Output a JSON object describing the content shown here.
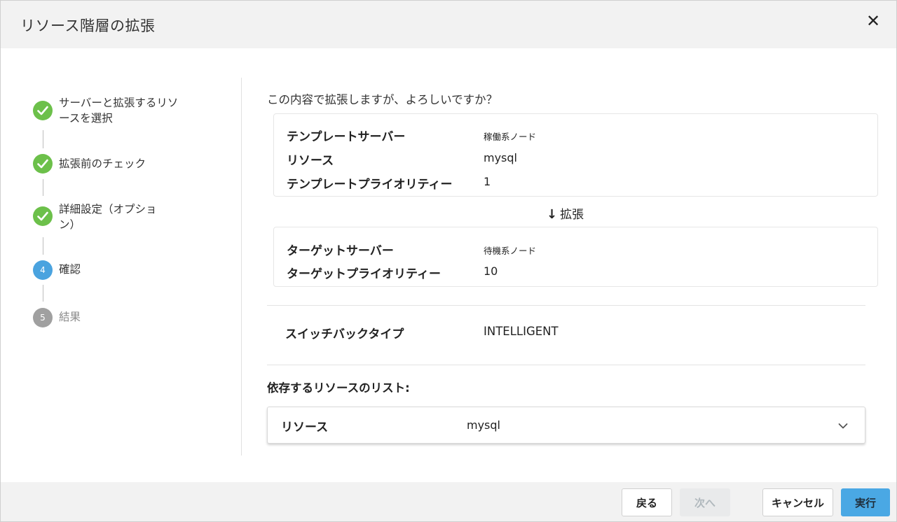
{
  "dialog": {
    "title": "リソース階層の拡張",
    "close_label": "✕"
  },
  "stepper": {
    "steps": [
      {
        "label": "サーバーと拡張するリソースを選択",
        "status": "done",
        "number": "1"
      },
      {
        "label": "拡張前のチェック",
        "status": "done",
        "number": "2"
      },
      {
        "label": "詳細設定（オプション）",
        "status": "done",
        "number": "3"
      },
      {
        "label": "確認",
        "status": "current",
        "number": "4"
      },
      {
        "label": "結果",
        "status": "pending",
        "number": "5"
      }
    ]
  },
  "confirm": {
    "question": "この内容で拡張しますが、よろしいですか？",
    "template": {
      "server_label": "テンプレートサーバー",
      "server_value": "稼働系ノード",
      "resource_label": "リソース",
      "resource_value": "mysql",
      "priority_label": "テンプレートプライオリティー",
      "priority_value": "1"
    },
    "expand_text": "拡張",
    "target": {
      "server_label": "ターゲットサーバー",
      "server_value": "待機系ノード",
      "priority_label": "ターゲットプライオリティー",
      "priority_value": "10"
    },
    "switchback_label": "スイッチバックタイプ",
    "switchback_value": "INTELLIGENT",
    "deps_title": "依存するリソースのリスト:",
    "deps": {
      "resource_label": "リソース",
      "resource_value": "mysql"
    }
  },
  "footer": {
    "back_label": "戻る",
    "next_label": "次へ",
    "cancel_label": "キャンセル",
    "run_label": "実行"
  },
  "colors": {
    "done": "#6cc04a",
    "current": "#4aa3df",
    "pending": "#a0a0a0",
    "primary_button": "#4aa8e4"
  }
}
